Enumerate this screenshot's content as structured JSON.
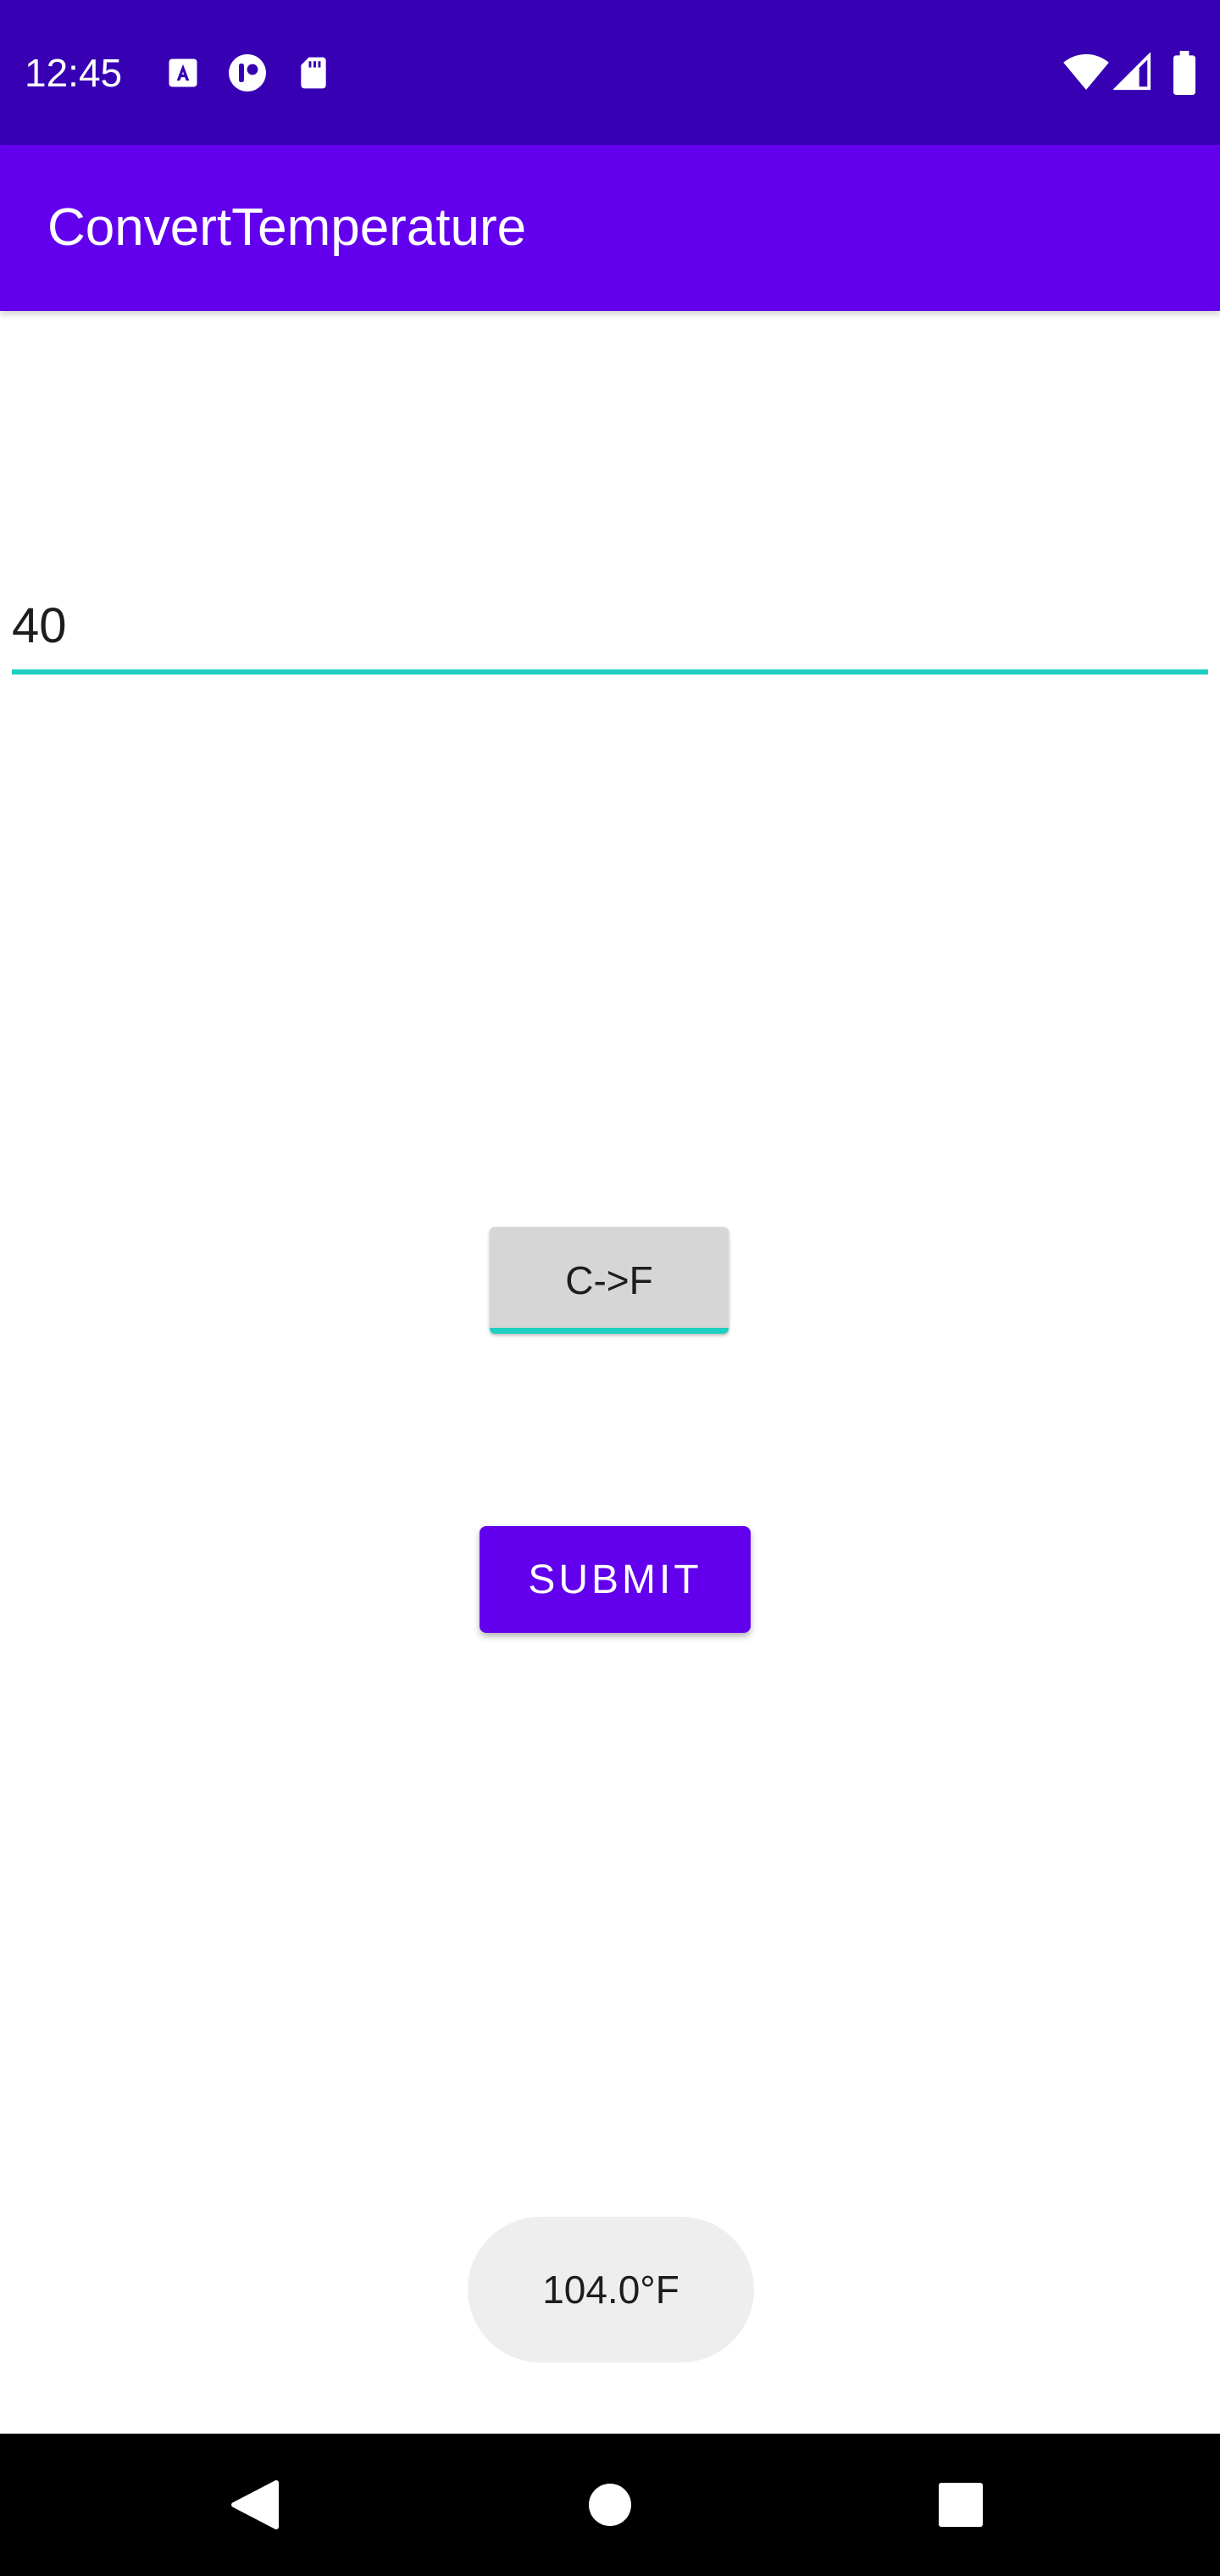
{
  "status_bar": {
    "time": "12:45",
    "background": "#3700b3",
    "left_icons": [
      "font-icon",
      "account-circle-icon",
      "sd-card-icon"
    ],
    "right_icons": [
      "wifi-icon",
      "cell-signal-icon",
      "battery-icon"
    ]
  },
  "app_bar": {
    "title": "ConvertTemperature",
    "background": "#6200ee"
  },
  "form": {
    "temperature_value": "40",
    "toggle_label": "C->F",
    "submit_label": "SUBMIT",
    "accent_color": "#1fcfc0"
  },
  "toast": {
    "message": "104.0°F"
  },
  "nav_bar": {
    "buttons": [
      "back-icon",
      "home-icon",
      "recents-icon"
    ]
  }
}
